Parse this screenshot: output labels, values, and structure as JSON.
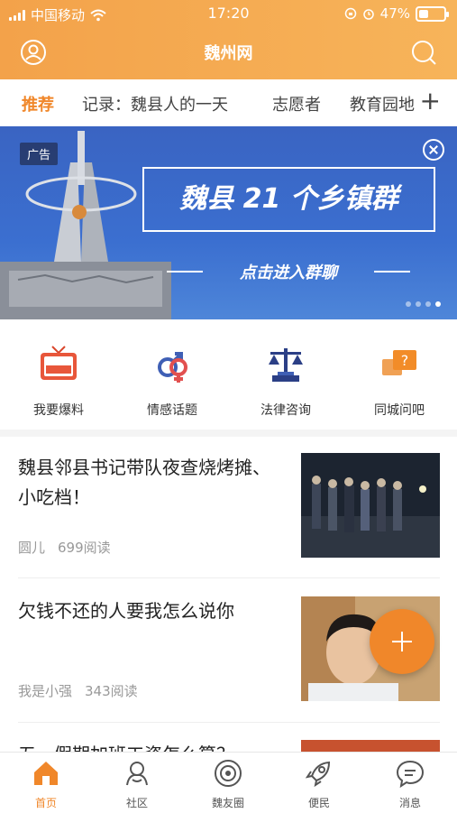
{
  "status_bar": {
    "carrier": "中国移动",
    "time": "17:20",
    "battery": "47%",
    "battery_level": 0.47
  },
  "app_bar": {
    "title": "魏州网",
    "left_icon": "user-icon",
    "right_icon": "search-icon"
  },
  "tabs": {
    "items": [
      {
        "label": "推荐",
        "active": true
      },
      {
        "label": "记录：魏县人的一天",
        "active": false
      },
      {
        "label": "志愿者",
        "active": false
      },
      {
        "label": "教育园地",
        "active": false
      }
    ],
    "more": "+"
  },
  "banner": {
    "ad_label": "广告",
    "headline": "魏县 21 个乡镇群",
    "subline": "点击进入群聊",
    "page_count": 4,
    "current_page": 4
  },
  "shortcuts": [
    {
      "label": "我要爆料",
      "icon": "tv-news-icon"
    },
    {
      "label": "情感话题",
      "icon": "gender-icon"
    },
    {
      "label": "法律咨询",
      "icon": "scales-icon"
    },
    {
      "label": "同城问吧",
      "icon": "question-chat-icon"
    }
  ],
  "news": [
    {
      "title": "魏县邻县书记带队夜查烧烤摊、小吃档！",
      "author": "圆儿",
      "reads": "699阅读"
    },
    {
      "title": "欠钱不还的人要我怎么说你",
      "author": "我是小强",
      "reads": "343阅读"
    },
    {
      "title": "五一假期加班工资怎么算？",
      "author": "",
      "reads": ""
    }
  ],
  "fab": {
    "icon": "plus-icon"
  },
  "bottom_nav": [
    {
      "label": "首页",
      "icon": "home-icon",
      "active": true
    },
    {
      "label": "社区",
      "icon": "community-icon",
      "active": false
    },
    {
      "label": "魏友圈",
      "icon": "circle-icon",
      "active": false
    },
    {
      "label": "便民",
      "icon": "rocket-icon",
      "active": false
    },
    {
      "label": "消息",
      "icon": "message-icon",
      "active": false
    }
  ],
  "colors": {
    "accent": "#f0872a",
    "header": "#f5a94f",
    "banner": "#3b6fd0"
  }
}
